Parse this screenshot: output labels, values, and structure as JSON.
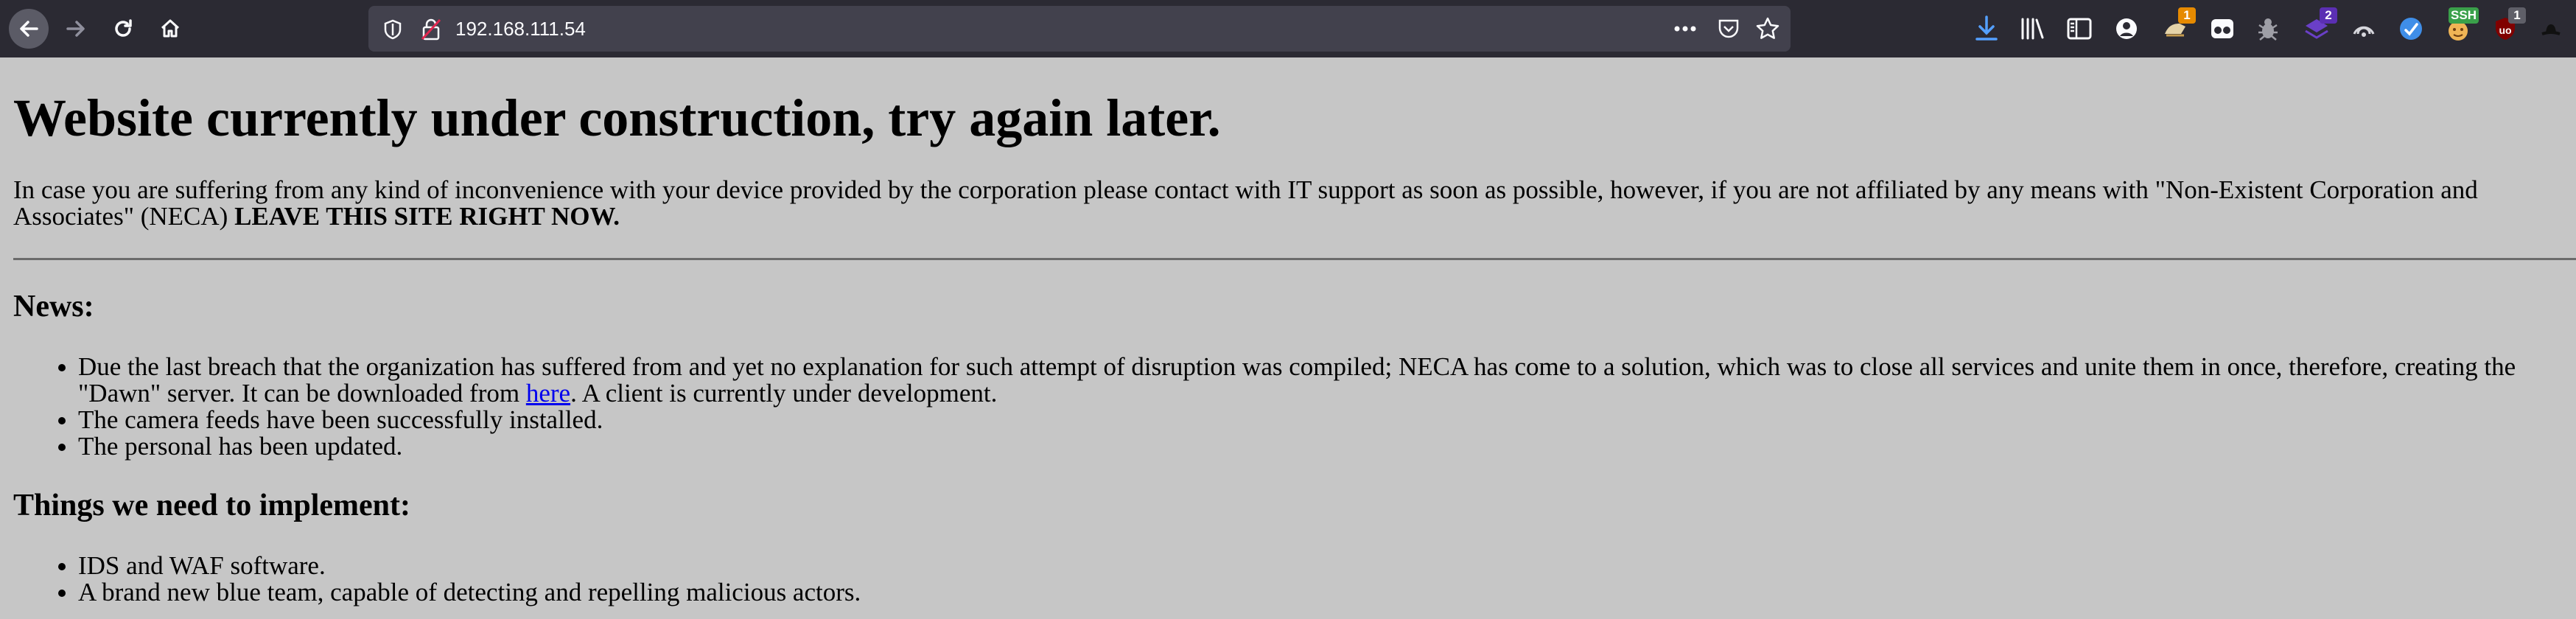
{
  "browser": {
    "url": "192.168.111.54",
    "extensions": [
      {
        "name": "downloads-icon",
        "badge": ""
      },
      {
        "name": "library-icon",
        "badge": ""
      },
      {
        "name": "sidebar-icon",
        "badge": ""
      },
      {
        "name": "account-icon",
        "badge": ""
      },
      {
        "name": "extension-1",
        "badge": "1"
      },
      {
        "name": "extension-glasses",
        "badge": ""
      },
      {
        "name": "extension-bug",
        "badge": ""
      },
      {
        "name": "extension-2",
        "badge": "2"
      },
      {
        "name": "extension-wifi",
        "badge": ""
      },
      {
        "name": "extension-check",
        "badge": ""
      },
      {
        "name": "extension-ssh",
        "badge": "SSH"
      },
      {
        "name": "extension-ublock",
        "badge": "1"
      },
      {
        "name": "extension-hat",
        "badge": ""
      }
    ],
    "colors": {
      "toolbar": "#2b2a33",
      "urlbar": "#42414d",
      "page_background": "#c6c6c6",
      "link": "#0000ee"
    }
  },
  "page": {
    "title": "Website currently under construction, try again later.",
    "intro": "In case you are suffering from any kind of inconvenience with your device provided by the corporation please contact with IT support as soon as possible, however, if you are not affiliated by any means with \"Non-Existent Corporation and Associates\" (NECA) ",
    "intro_bold": "LEAVE THIS SITE RIGHT NOW.",
    "news_heading": "News:",
    "news": {
      "item1_before": "Due the last breach that the organization has suffered from and yet no explanation for such attempt of disruption was compiled; NECA has come to a solution, which was to close all services and unite them in once, therefore, creating the \"Dawn\" server. It can be downloaded from ",
      "item1_link": "here",
      "item1_after": ". A client is currently under development.",
      "item2": "The camera feeds have been successfully installed.",
      "item3": "The personal has been updated."
    },
    "todo_heading": "Things we need to implement:",
    "todo": [
      "IDS and WAF software.",
      "A brand new blue team, capable of detecting and repelling malicious actors."
    ]
  }
}
